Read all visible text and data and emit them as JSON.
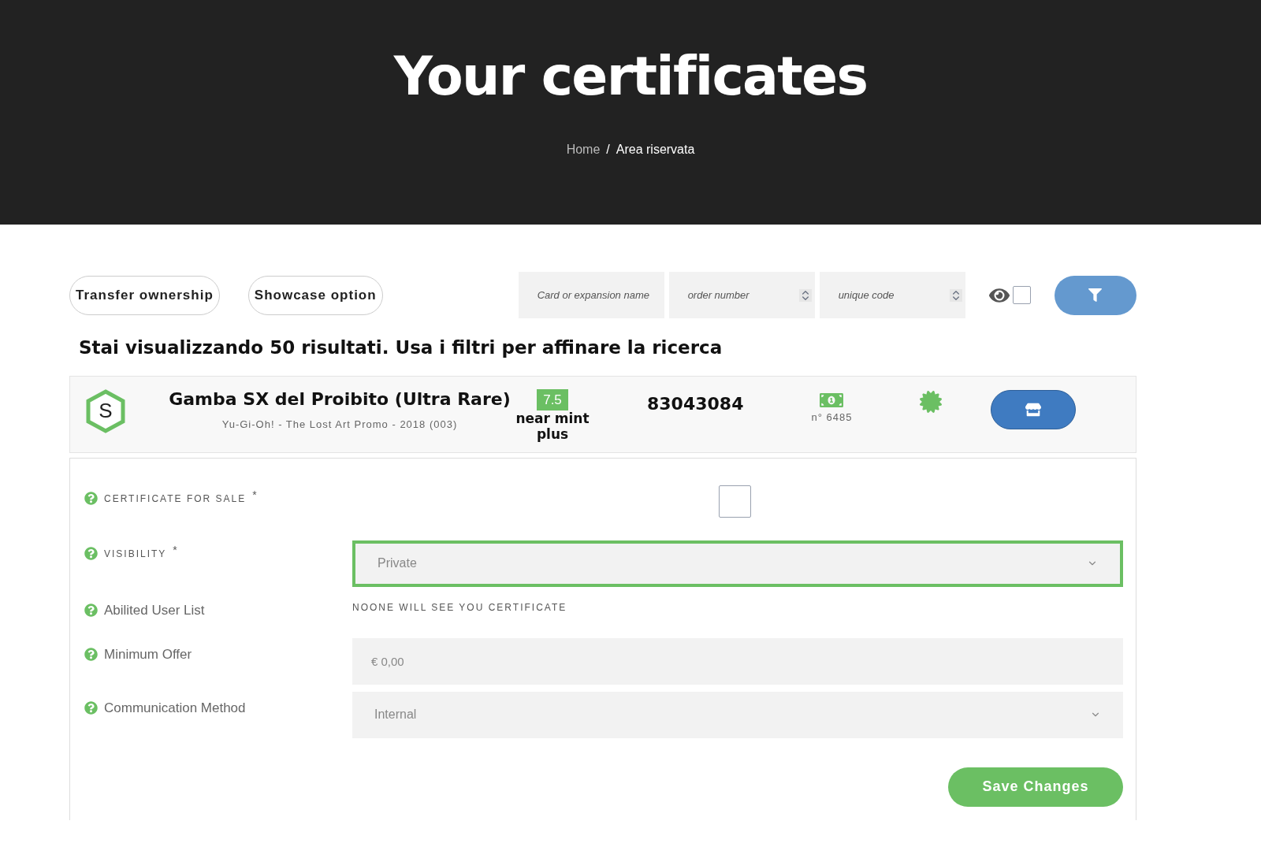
{
  "header": {
    "title": "Your certificates",
    "breadcrumb": [
      {
        "label": "Home",
        "selected": false
      },
      {
        "label": "Area riservata",
        "selected": true
      }
    ],
    "separator": "/"
  },
  "toolbar": {
    "buttons": [
      "Transfer ownership",
      "Showcase option"
    ],
    "filters": [
      {
        "kind": "text",
        "placeholder": "Card or expansion name"
      },
      {
        "kind": "number",
        "placeholder": "order number"
      },
      {
        "kind": "number",
        "placeholder": "unique code"
      }
    ],
    "show_hidden": {
      "checked": false
    }
  },
  "results_note": "Stai visualizzando 50 risultati. Usa i filtri per affinare la ricerca",
  "certificate": {
    "badge": "S",
    "name": "Gamba SX del Proibito (Ultra Rare)",
    "set": "Yu-Gi-Oh! - The Lost Art Promo - 2018 (003)",
    "grade": "7.5",
    "grade_label": "near mint plus",
    "code": "83043084",
    "order": "n° 6485"
  },
  "form": {
    "rows": [
      {
        "kind": "checkbox",
        "label": "CERTIFICATE FOR SALE",
        "caps": true,
        "marker": "*",
        "checked": false
      },
      {
        "kind": "select",
        "label": "VISIBILITY",
        "caps": true,
        "marker": "*",
        "value": "Private",
        "focused": true
      },
      {
        "kind": "note",
        "label": "Abilited User List",
        "caps": false,
        "text": "NOONE WILL SEE YOU CERTIFICATE"
      },
      {
        "kind": "input",
        "label": "Minimum Offer",
        "caps": false,
        "placeholder": "€ 0,00"
      },
      {
        "kind": "select",
        "label": "Communication Method",
        "caps": false,
        "value": "Internal",
        "focused": false
      }
    ],
    "save": "Save Changes"
  }
}
